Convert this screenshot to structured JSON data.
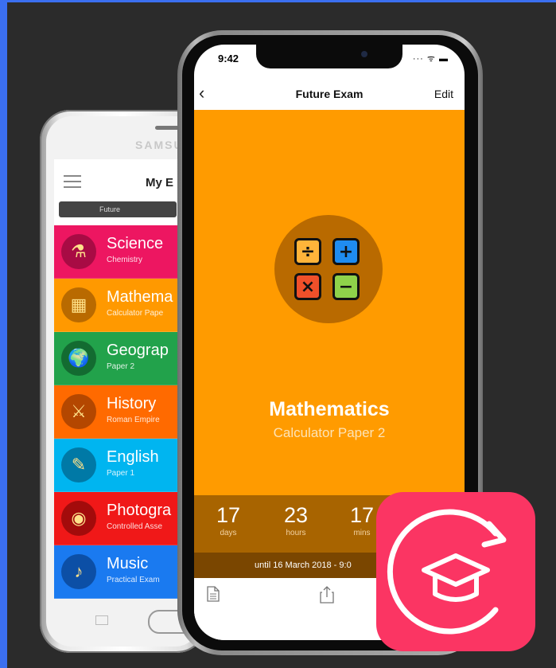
{
  "back_phone": {
    "brand": "SAMSUNG",
    "title": "My E",
    "tab": "Future",
    "subjects": [
      {
        "name": "Science",
        "sub": "Chemistry",
        "bg": "#ed1661",
        "icon_bg": "#a80b44",
        "icon": "⚗"
      },
      {
        "name": "Mathema",
        "sub": "Calculator Pape",
        "bg": "#ff9900",
        "icon_bg": "#b96a00",
        "icon": "▦"
      },
      {
        "name": "Geograp",
        "sub": "Paper 2",
        "bg": "#22a24b",
        "icon_bg": "#136b31",
        "icon": "🌍"
      },
      {
        "name": "History",
        "sub": "Roman Empire",
        "bg": "#ff6a00",
        "icon_bg": "#b44700",
        "icon": "⚔"
      },
      {
        "name": "English",
        "sub": "Paper 1",
        "bg": "#00b5f0",
        "icon_bg": "#0079a6",
        "icon": "✎"
      },
      {
        "name": "Photogra",
        "sub": "Controlled Asse",
        "bg": "#f01818",
        "icon_bg": "#a30b0b",
        "icon": "◉"
      },
      {
        "name": "Music",
        "sub": "Practical Exam",
        "bg": "#1a7af0",
        "icon_bg": "#0c4fa6",
        "icon": "♪"
      }
    ]
  },
  "front_phone": {
    "status_time": "9:42",
    "status_icons": "··· ᯤ ▬",
    "nav": {
      "back": "‹",
      "title": "Future Exam",
      "edit": "Edit"
    },
    "subject": {
      "title": "Mathematics",
      "subtitle": "Calculator Paper 2"
    },
    "calc_keys": [
      {
        "symbol": "÷",
        "color": "#ffb43a"
      },
      {
        "symbol": "+",
        "color": "#1f8cf0"
      },
      {
        "symbol": "×",
        "color": "#f0502a"
      },
      {
        "symbol": "−",
        "color": "#8fd24a"
      }
    ],
    "countdown": [
      {
        "value": "17",
        "unit": "days"
      },
      {
        "value": "23",
        "unit": "hours"
      },
      {
        "value": "17",
        "unit": "mins"
      }
    ],
    "until": "until 16 March 2018 - 9:0"
  },
  "colors": {
    "hero": "#ff9b00",
    "badge": "#fb3563",
    "background": "#2b2b2b"
  }
}
